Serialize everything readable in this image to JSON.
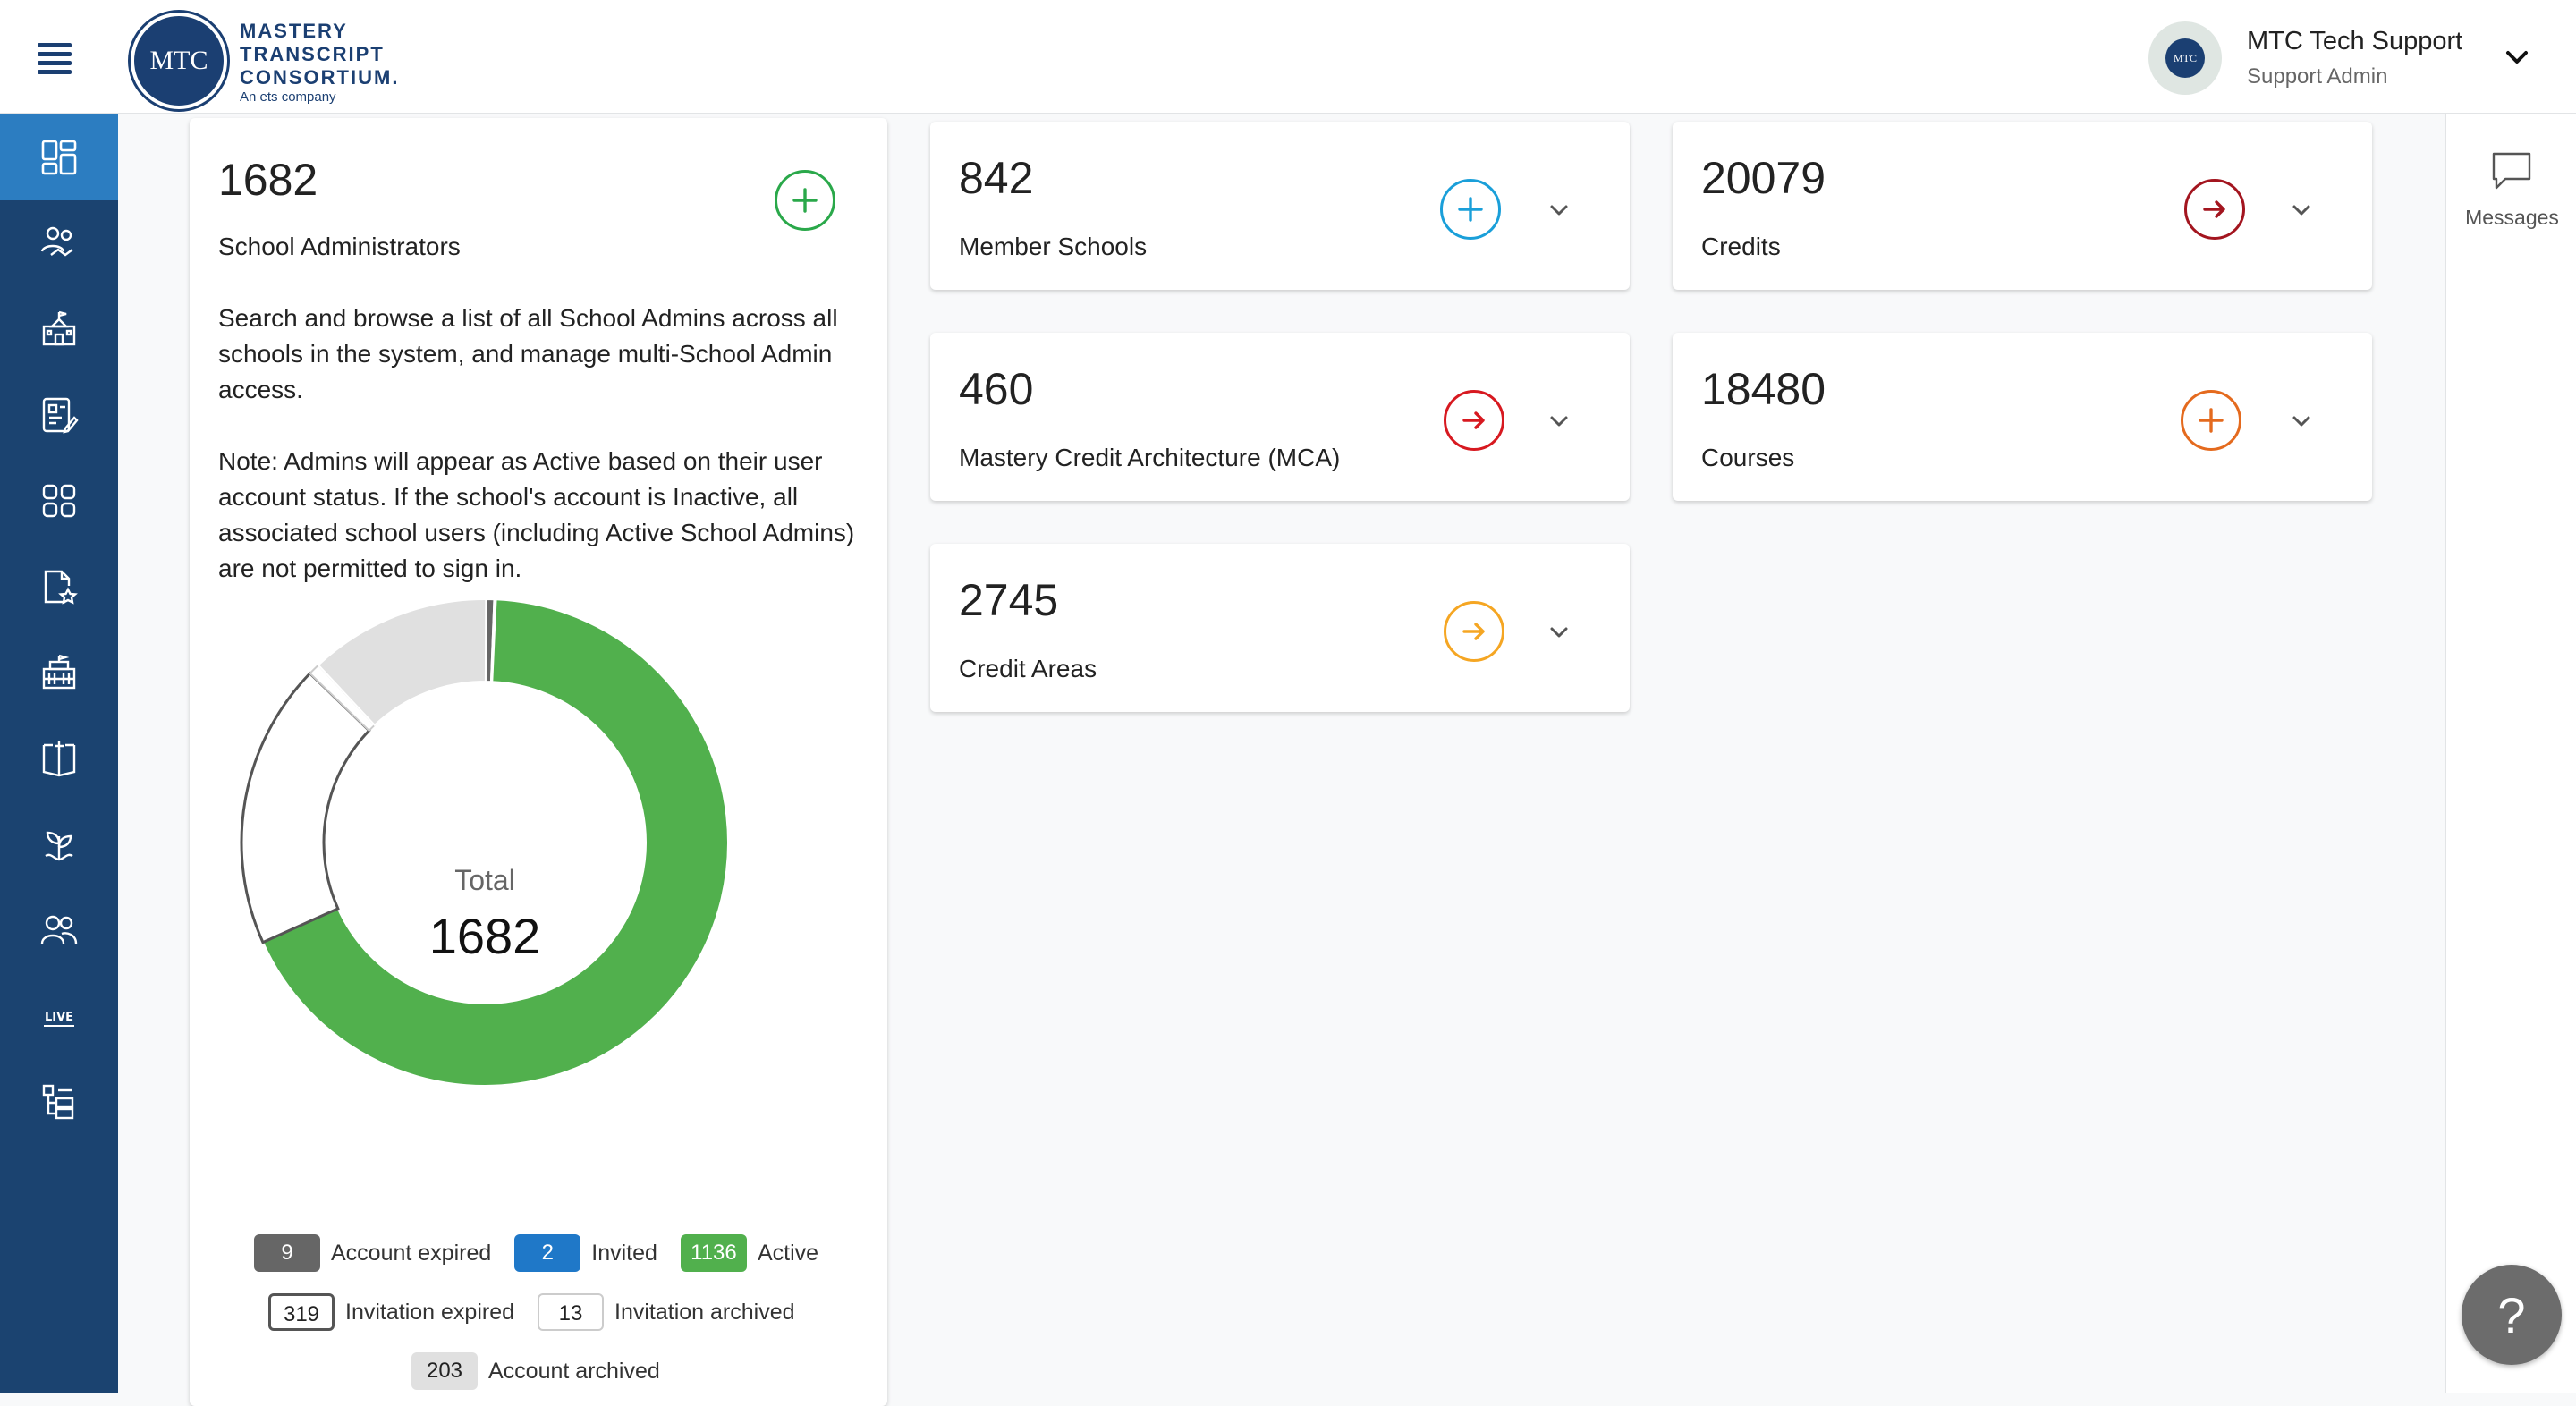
{
  "header": {
    "logo_mark": "MTC",
    "logo_line1": "MASTERY",
    "logo_line2": "TRANSCRIPT",
    "logo_line3": "CONSORTIUM.",
    "logo_sub": "An ets company",
    "user_avatar_text": "MTC",
    "user_name": "MTC Tech Support",
    "user_role": "Support Admin"
  },
  "sidebar": {
    "items": [
      {
        "icon": "dashboard-icon",
        "active": true
      },
      {
        "icon": "users-handshake-icon"
      },
      {
        "icon": "schools-icon"
      },
      {
        "icon": "report-edit-icon"
      },
      {
        "icon": "apps-grid-icon"
      },
      {
        "icon": "document-star-icon"
      },
      {
        "icon": "institution-icon"
      },
      {
        "icon": "book-plus-icon"
      },
      {
        "icon": "growth-plant-icon"
      },
      {
        "icon": "people-group-icon"
      },
      {
        "icon": "live-icon",
        "text": "LIVE"
      },
      {
        "icon": "hierarchy-icon"
      }
    ]
  },
  "rail": {
    "messages_label": "Messages"
  },
  "admins_card": {
    "count": "1682",
    "label": "School Administrators",
    "desc_p1": "Search and browse a list of all School Admins across all schools in the system, and manage multi-School Admin access.",
    "desc_p2": "Note: Admins will appear as Active based on their user account status. If the school's account is Inactive, all associated school users (including Active School Admins) are not permitted to sign in.",
    "total_label": "Total",
    "total_value": "1682",
    "legend": {
      "expired_value": "9",
      "expired_label": "Account expired",
      "invited_value": "2",
      "invited_label": "Invited",
      "active_value": "1136",
      "active_label": "Active",
      "inv_expired_value": "319",
      "inv_expired_label": "Invitation expired",
      "inv_archived_value": "13",
      "inv_archived_label": "Invitation archived",
      "acc_archived_value": "203",
      "acc_archived_label": "Account archived"
    }
  },
  "cards": {
    "member_schools": {
      "count": "842",
      "label": "Member Schools",
      "color": "#1a9fd9"
    },
    "credits": {
      "count": "20079",
      "label": "Credits",
      "color": "#a3151f"
    },
    "mca": {
      "count": "460",
      "label": "Mastery Credit Architecture (MCA)",
      "color": "#d71920"
    },
    "courses": {
      "count": "18480",
      "label": "Courses",
      "color": "#e46a1e"
    },
    "credit_areas": {
      "count": "2745",
      "label": "Credit Areas",
      "color": "#f5a623"
    }
  },
  "chart_data": {
    "type": "pie",
    "title": "",
    "categories": [
      "Account expired",
      "Invited",
      "Active",
      "Invitation expired",
      "Invitation archived",
      "Account archived"
    ],
    "values": [
      9,
      2,
      1136,
      319,
      13,
      203
    ],
    "colors": [
      "#666666",
      "#1f78c8",
      "#51b04d",
      "#ffffff",
      "#ffffff",
      "#e0e0e0"
    ],
    "total": 1682
  },
  "help": {
    "label": "?"
  }
}
